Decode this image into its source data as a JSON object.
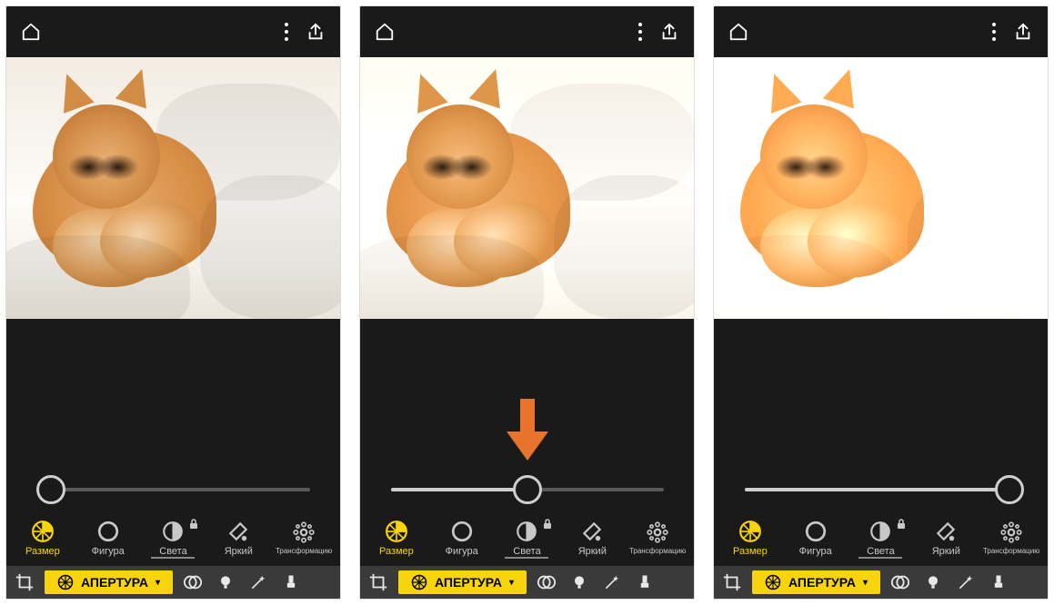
{
  "panels": [
    {
      "slider_pos": 0.05
    },
    {
      "slider_pos": 0.5,
      "show_arrow": true
    },
    {
      "slider_pos": 0.97
    }
  ],
  "tools": {
    "size": {
      "label": "Размер",
      "active": true
    },
    "shape": {
      "label": "Фигура"
    },
    "light": {
      "label": "Света",
      "locked": true,
      "underlined": true
    },
    "bright": {
      "label": "Яркий"
    },
    "trans": {
      "label": "Трансформацию",
      "small": true
    }
  },
  "aperture_label": "АПЕРТУРА"
}
